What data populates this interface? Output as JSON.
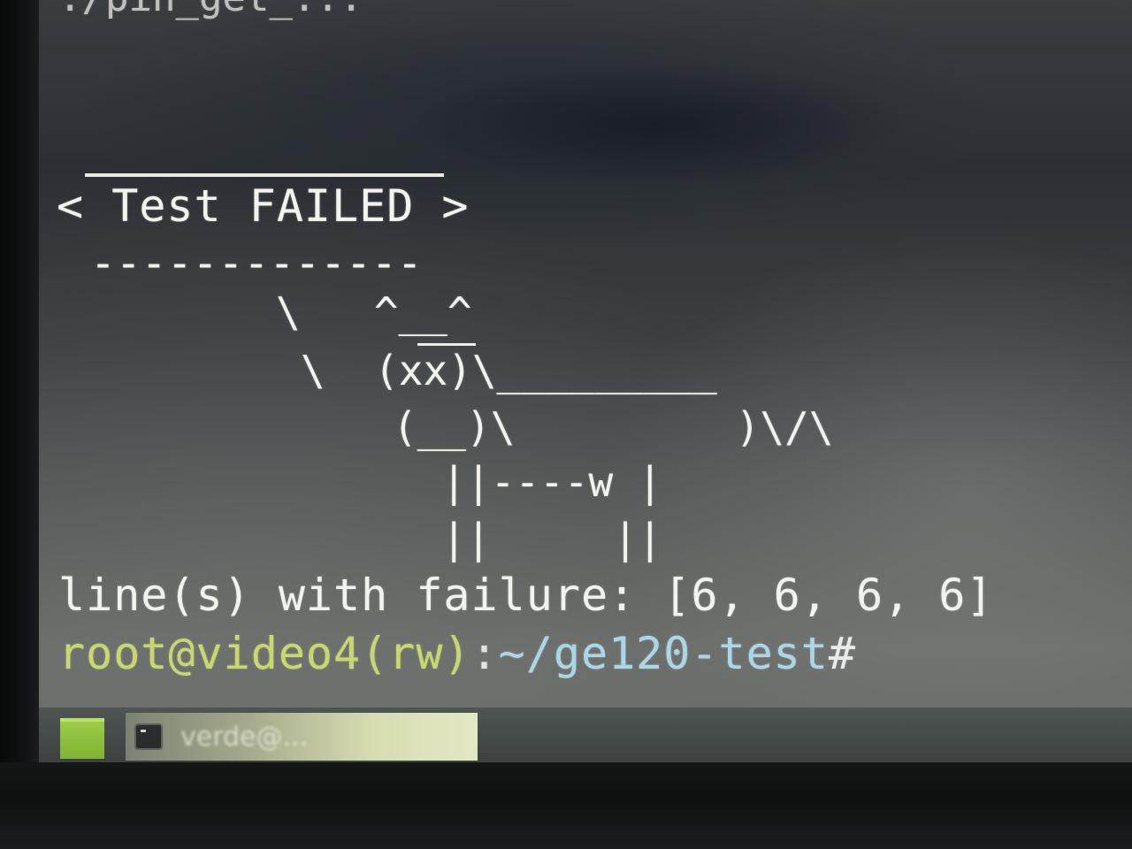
{
  "terminal": {
    "top_cutoff": "./pin_get_...",
    "bubble_text": "< Test FAILED >",
    "bubble_bottom": "-------------",
    "cow_lines": [
      "\\   ^__^",
      "\\  (xx)\\_________",
      "(__)\\         )\\/\\",
      "  ||----w |",
      "  ||     ||"
    ],
    "failure_line": "line(s) with failure: [6, 6, 6, 6]",
    "prompt": {
      "user_host": "root@video4(rw)",
      "separator": ":",
      "path": "~/ge120-test",
      "symbol": "#"
    },
    "colors": {
      "prompt_user": "#c9d86a",
      "prompt_path": "#a9d7e8",
      "text": "#f3f3ee"
    }
  },
  "taskbar": {
    "menu_icon": "menu-icon",
    "task_icon": "terminal-icon",
    "task_label": "verde@..."
  }
}
